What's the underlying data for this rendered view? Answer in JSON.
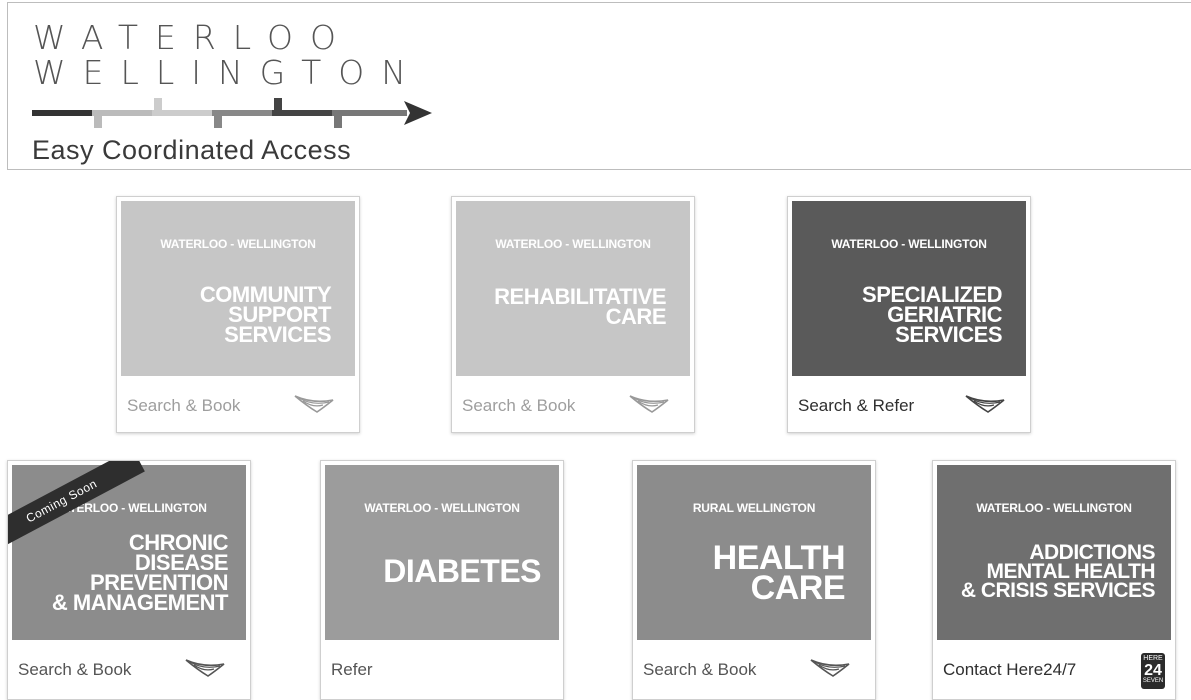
{
  "header": {
    "logo_line1": "WATERLOO",
    "logo_line2": "WELLINGTON",
    "tagline": "Easy Coordinated Access"
  },
  "cards": [
    {
      "subtitle": "WATERLOO - WELLINGTON",
      "title_lines": [
        "COMMUNITY",
        "SUPPORT",
        "SERVICES"
      ],
      "action": "Search & Book",
      "icon": "swoosh-icon",
      "tile_color": "#c6c6c6"
    },
    {
      "subtitle": "WATERLOO - WELLINGTON",
      "title_lines": [
        "REHABILITATIVE",
        "CARE"
      ],
      "action": "Search & Book",
      "icon": "swoosh-icon",
      "tile_color": "#c6c6c6"
    },
    {
      "subtitle": "WATERLOO - WELLINGTON",
      "title_lines": [
        "SPECIALIZED",
        "GERIATRIC",
        "SERVICES"
      ],
      "action": "Search & Refer",
      "icon": "swoosh-icon",
      "tile_color": "#5a5a5a"
    },
    {
      "subtitle": "WATERLOO - WELLINGTON",
      "title_lines": [
        "CHRONIC",
        "DISEASE",
        "PREVENTION",
        "& MANAGEMENT"
      ],
      "action": "Search & Book",
      "icon": "swoosh-icon",
      "ribbon": "Coming Soon",
      "tile_color": "#8c8c8c"
    },
    {
      "subtitle": "WATERLOO - WELLINGTON",
      "title_lines": [
        "DIABETES"
      ],
      "action": "Refer",
      "tile_color": "#9c9c9c"
    },
    {
      "subtitle": "RURAL WELLINGTON",
      "title_lines": [
        "HEALTH",
        "CARE"
      ],
      "action": "Search & Book",
      "icon": "swoosh-icon",
      "tile_color": "#8c8c8c"
    },
    {
      "subtitle": "WATERLOO - WELLINGTON",
      "title_lines": [
        "ADDICTIONS",
        "MENTAL HEALTH",
        "& CRISIS SERVICES"
      ],
      "action": "Contact Here24/7",
      "icon": "here247-icon",
      "icon_text": [
        "HERE",
        "24",
        "SEVEN"
      ],
      "tile_color": "#6f6f6f"
    }
  ]
}
